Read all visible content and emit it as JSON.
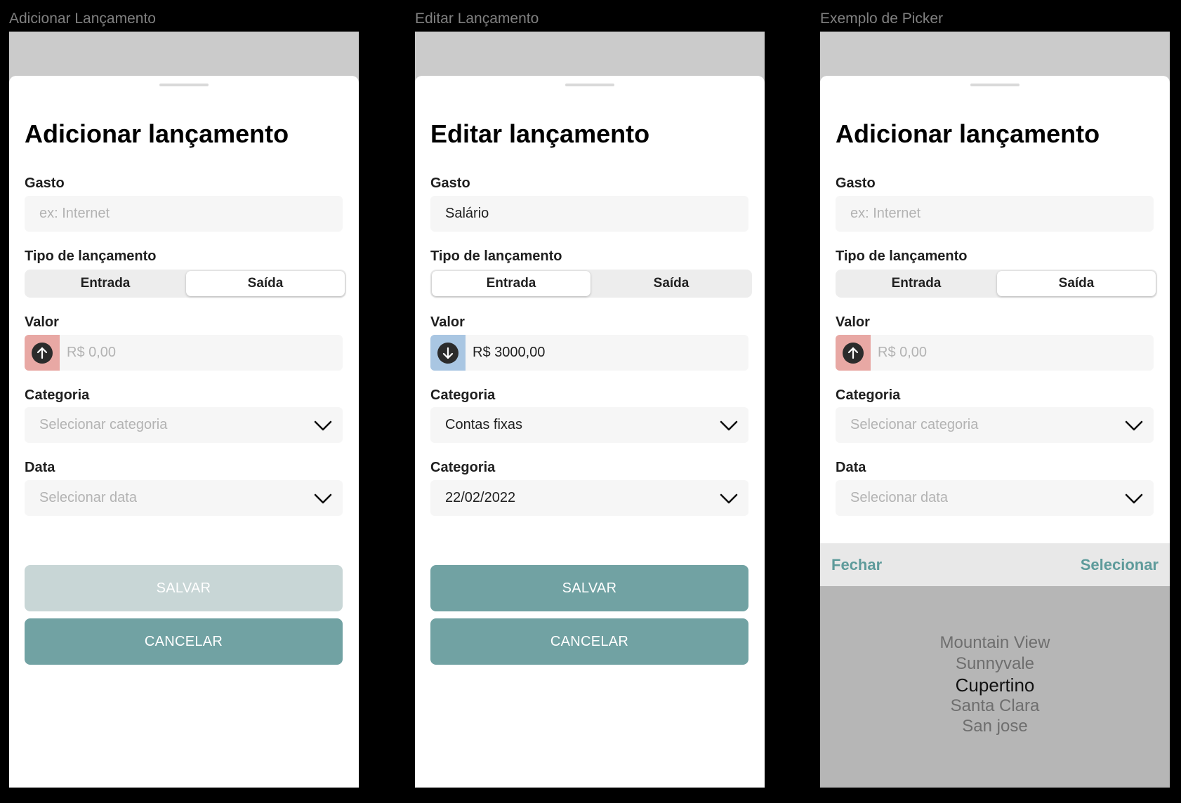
{
  "screens": [
    {
      "frame_label": "Adicionar Lançamento",
      "title": "Adicionar lançamento",
      "gasto_label": "Gasto",
      "gasto_placeholder": "ex: Internet",
      "gasto_value": "",
      "tipo_label": "Tipo de lançamento",
      "tipo_options": [
        "Entrada",
        "Saída"
      ],
      "tipo_selected": "Saída",
      "valor_label": "Valor",
      "valor_placeholder": "R$ 0,00",
      "valor_value": "",
      "valor_icon": "arrow-up-circle-icon",
      "categoria_label": "Categoria",
      "categoria_placeholder": "Selecionar categoria",
      "categoria_value": "",
      "data_label": "Data",
      "data_placeholder": "Selecionar data",
      "data_value": "",
      "save_label": "SALVAR",
      "save_enabled": false,
      "cancel_label": "CANCELAR"
    },
    {
      "frame_label": "Editar Lançamento",
      "title": "Editar lançamento",
      "gasto_label": "Gasto",
      "gasto_placeholder": "",
      "gasto_value": "Salário",
      "tipo_label": "Tipo de lançamento",
      "tipo_options": [
        "Entrada",
        "Saída"
      ],
      "tipo_selected": "Entrada",
      "valor_label": "Valor",
      "valor_placeholder": "",
      "valor_value": "R$ 3000,00",
      "valor_icon": "arrow-down-circle-icon",
      "categoria_label": "Categoria",
      "categoria_placeholder": "",
      "categoria_value": "Contas fixas",
      "data_label": "Categoria",
      "data_placeholder": "",
      "data_value": "22/02/2022",
      "save_label": "SALVAR",
      "save_enabled": true,
      "cancel_label": "CANCELAR"
    },
    {
      "frame_label": "Exemplo de Picker",
      "title": "Adicionar lançamento",
      "gasto_label": "Gasto",
      "gasto_placeholder": "ex: Internet",
      "gasto_value": "",
      "tipo_label": "Tipo de lançamento",
      "tipo_options": [
        "Entrada",
        "Saída"
      ],
      "tipo_selected": "Saída",
      "valor_label": "Valor",
      "valor_placeholder": "R$ 0,00",
      "valor_value": "",
      "valor_icon": "arrow-up-circle-icon",
      "categoria_label": "Categoria",
      "categoria_placeholder": "Selecionar categoria",
      "categoria_value": "",
      "data_label": "Data",
      "data_placeholder": "Selecionar data",
      "data_value": "",
      "picker": {
        "close_label": "Fechar",
        "select_label": "Selecionar",
        "options": [
          "Mountain View",
          "Sunnyvale",
          "Cupertino",
          "Santa Clara",
          "San jose"
        ],
        "selected": "Cupertino"
      }
    }
  ],
  "colors": {
    "primary": "#71a2a3",
    "primary_disabled": "#c8d6d6",
    "saida_accent": "#e8a8a4",
    "entrada_accent": "#a9c6e2",
    "picker_accent": "#5e9b9b"
  }
}
